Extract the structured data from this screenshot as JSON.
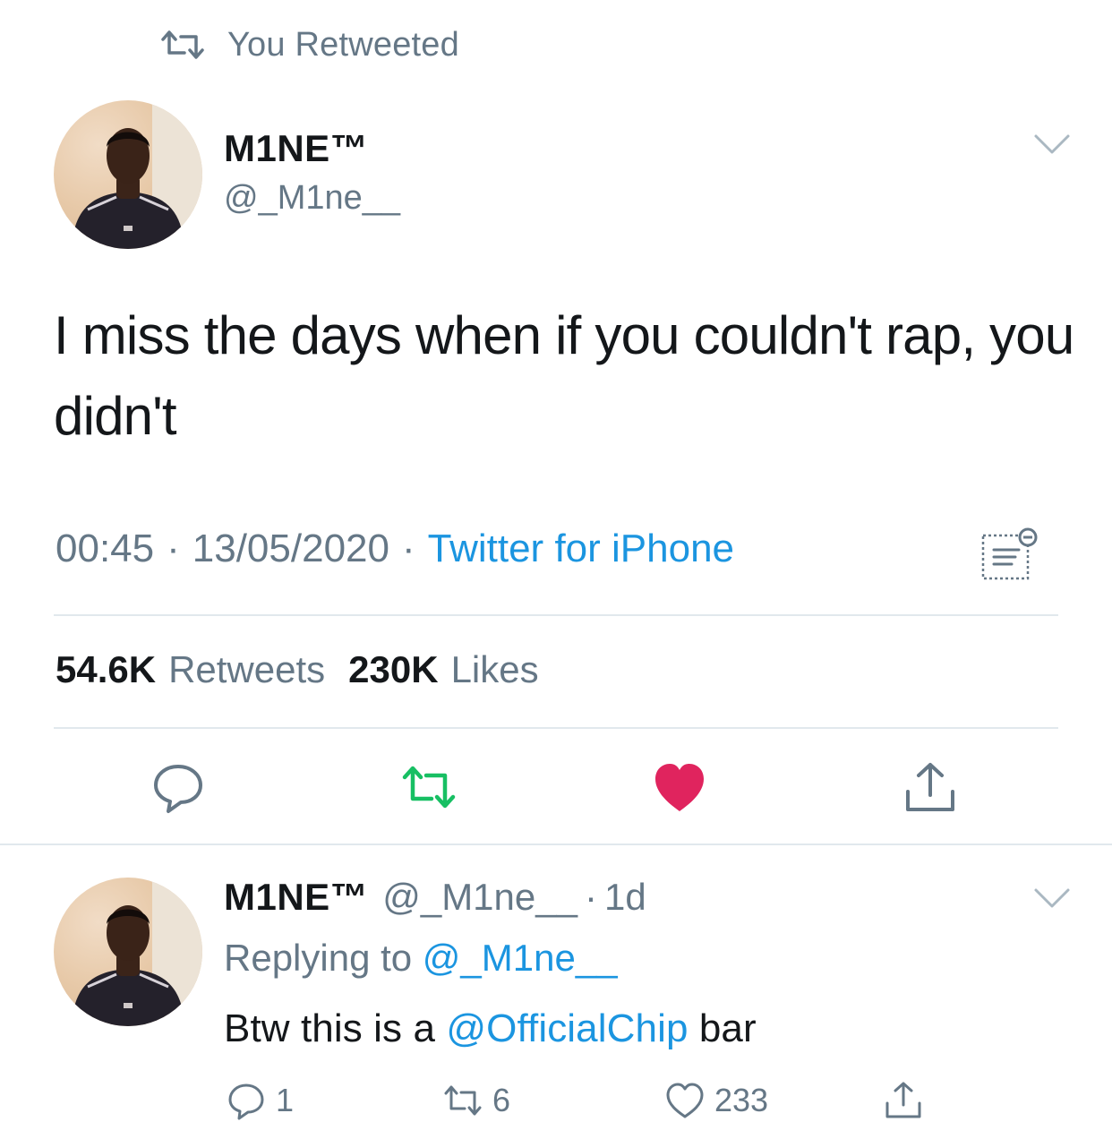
{
  "retweet_banner": {
    "text": "You Retweeted",
    "icon": "retweet-icon"
  },
  "main_tweet": {
    "author_name": "M1NE™",
    "author_handle": "@_M1ne__",
    "text": "I miss the days when if you couldn't rap, you didn't",
    "time": "00:45",
    "date": "13/05/2020",
    "source": "Twitter for iPhone",
    "separator": "·",
    "retweets_count": "54.6K",
    "retweets_label": "Retweets",
    "likes_count": "230K",
    "likes_label": "Likes",
    "liked": true,
    "retweeted": true
  },
  "reply_tweet": {
    "author_name": "M1NE™",
    "author_handle": "@_M1ne__",
    "separator": "·",
    "time_ago": "1d",
    "replying_prefix": "Replying to",
    "replying_handle": "@_M1ne__",
    "text_before": "Btw this is a",
    "text_mention": "@OfficialChip",
    "text_after": "bar",
    "reply_count": "1",
    "retweet_count": "6",
    "like_count": "233"
  },
  "colors": {
    "text": "#14171a",
    "secondary": "#657786",
    "link": "#1b95e0",
    "retweet_green": "#17bf63",
    "like_red": "#e0245e",
    "divider": "#e1e8ed"
  }
}
